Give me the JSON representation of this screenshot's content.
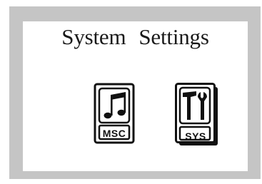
{
  "screen": {
    "title_word_1": "System",
    "title_word_2": "Settings",
    "background": "#ffffff",
    "bezel_color": "#c5c5c5"
  },
  "apps": [
    {
      "label": "MSC",
      "icon": "music-note-icon"
    },
    {
      "label": "SYS",
      "icon": "hammer-wrench-icon"
    }
  ]
}
